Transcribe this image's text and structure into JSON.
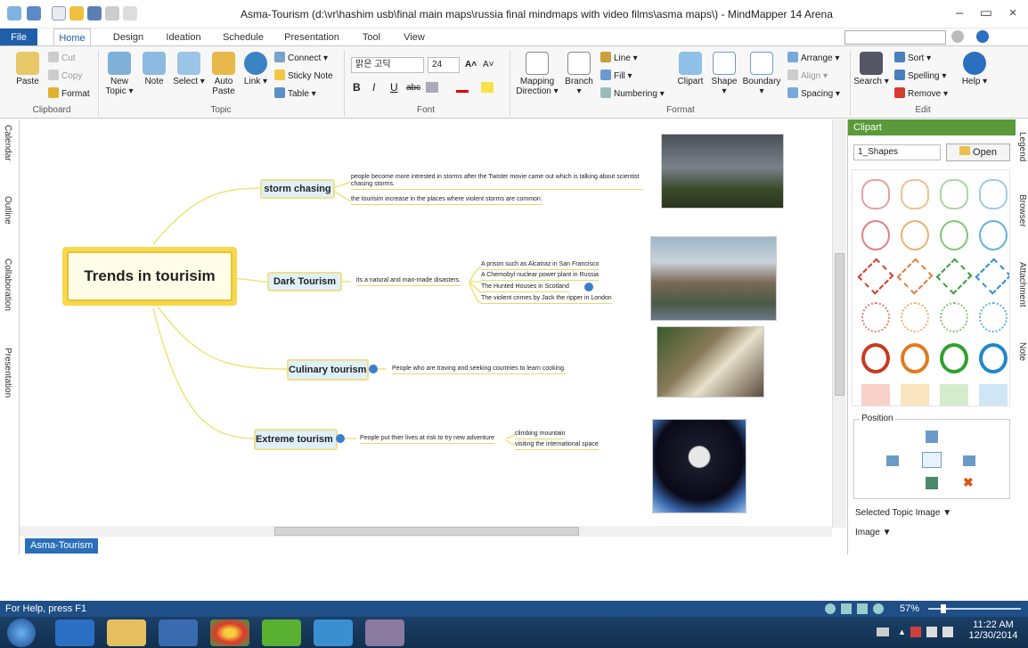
{
  "window": {
    "title": "Asma-Tourism (d:\\vr\\hashim usb\\final main maps\\russia final mindmaps with video films\\asma maps\\) - MindMapper 14 Arena"
  },
  "tabs": [
    "File",
    "Home",
    "Design",
    "Ideation",
    "Schedule",
    "Presentation",
    "Tool",
    "View"
  ],
  "ribbon": {
    "clipboard": {
      "paste": "Paste",
      "cut": "Cut",
      "copy": "Copy",
      "format": "Format",
      "label": "Clipboard"
    },
    "topic": {
      "new_topic": "New Topic ▾",
      "note": "Note",
      "select": "Select ▾",
      "auto_paste": "Auto Paste",
      "link": "Link ▾",
      "connect": "Connect ▾",
      "sticky": "Sticky Note",
      "table": "Table ▾",
      "label": "Topic"
    },
    "font": {
      "family": "맑은 고딕",
      "size": "24",
      "label": "Font"
    },
    "format": {
      "mapping": "Mapping Direction ▾",
      "branch": "Branch ▾",
      "line": "Line ▾",
      "fill": "Fill ▾",
      "numbering": "Numbering ▾",
      "clipart": "Clipart",
      "shape": "Shape ▾",
      "boundary": "Boundary ▾",
      "arrange": "Arrange ▾",
      "align": "Align ▾",
      "spacing": "Spacing ▾",
      "label": "Format"
    },
    "edit": {
      "search": "Search ▾",
      "sort": "Sort ▾",
      "spelling": "Spelling ▾",
      "remove": "Remove ▾",
      "help": "Help ▾",
      "label": "Edit"
    }
  },
  "sidebar": [
    "Calendar",
    "Outline",
    "Collaboration",
    "Presentation"
  ],
  "map": {
    "central": "Trends in tourisim",
    "topics": [
      {
        "label": "storm chasing",
        "notes": [
          "people become more intrested in storms after the Twister movie came out which is talking about scientist chasing storms.",
          "the tourisim increase in the places where violent storms are common."
        ]
      },
      {
        "label": "Dark Tourism",
        "notes": [
          "its a natural and man-made disasters."
        ],
        "subs": [
          "A prison such as Alcatraz in San Francisco",
          "A Chernobyl nuclear power plant in Russia",
          "The Hunted Houses in Scotland",
          "The violent crimes by Jack the ripper in London"
        ]
      },
      {
        "label": "Culinary tourism",
        "notes": [
          "People who are traving and seeking countries to learn cooking."
        ]
      },
      {
        "label": "Extreme tourism",
        "notes": [
          "People put thier lives at risk to try new adventure"
        ],
        "subs": [
          "climbing mountain",
          "visiting the international space"
        ]
      }
    ]
  },
  "sheet_tab": "Asma-Tourism",
  "clipart": {
    "header": "Clipart",
    "dropdown": "1_Shapes",
    "open": "Open",
    "position_label": "Position",
    "selected_image": "Selected Topic Image ▼",
    "image": "Image ▼"
  },
  "right_tabs": [
    "Legend",
    "Browser",
    "Attachment",
    "Note"
  ],
  "status": {
    "help": "For Help, press F1",
    "zoom": "57%"
  },
  "tray": {
    "time": "11:22 AM",
    "date": "12/30/2014"
  }
}
